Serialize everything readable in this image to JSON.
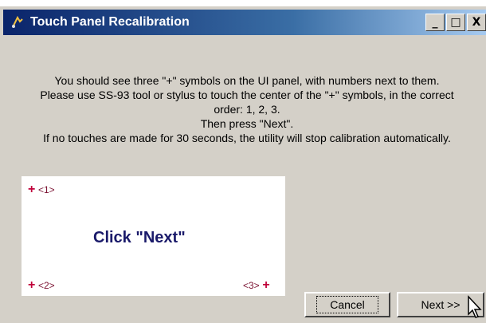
{
  "window": {
    "title": "Touch Panel Recalibration",
    "controls": {
      "minimize": "_",
      "maximize": "□",
      "close": "X"
    }
  },
  "instructions": {
    "line1": "You should see three \"+\" symbols on the UI panel, with numbers next to them.",
    "line2": "Please use SS-93 tool or stylus to touch the center of the \"+\" symbols, in the correct",
    "line3": "order: 1, 2, 3.",
    "line4": "Then press \"Next\".",
    "line5": "If no touches are made for 30 seconds, the utility will stop calibration automatically."
  },
  "preview": {
    "markers": [
      {
        "plus": "+",
        "label": "<1>"
      },
      {
        "plus": "+",
        "label": "<2>"
      },
      {
        "plus": "+",
        "label": "<3>"
      }
    ],
    "prompt": "Click \"Next\""
  },
  "buttons": {
    "cancel": "Cancel",
    "next": "Next >>"
  },
  "colors": {
    "title_bar": "#0a246a",
    "face": "#d4d0c8",
    "marker": "#c0003a",
    "prompt": "#1a1a6a"
  }
}
